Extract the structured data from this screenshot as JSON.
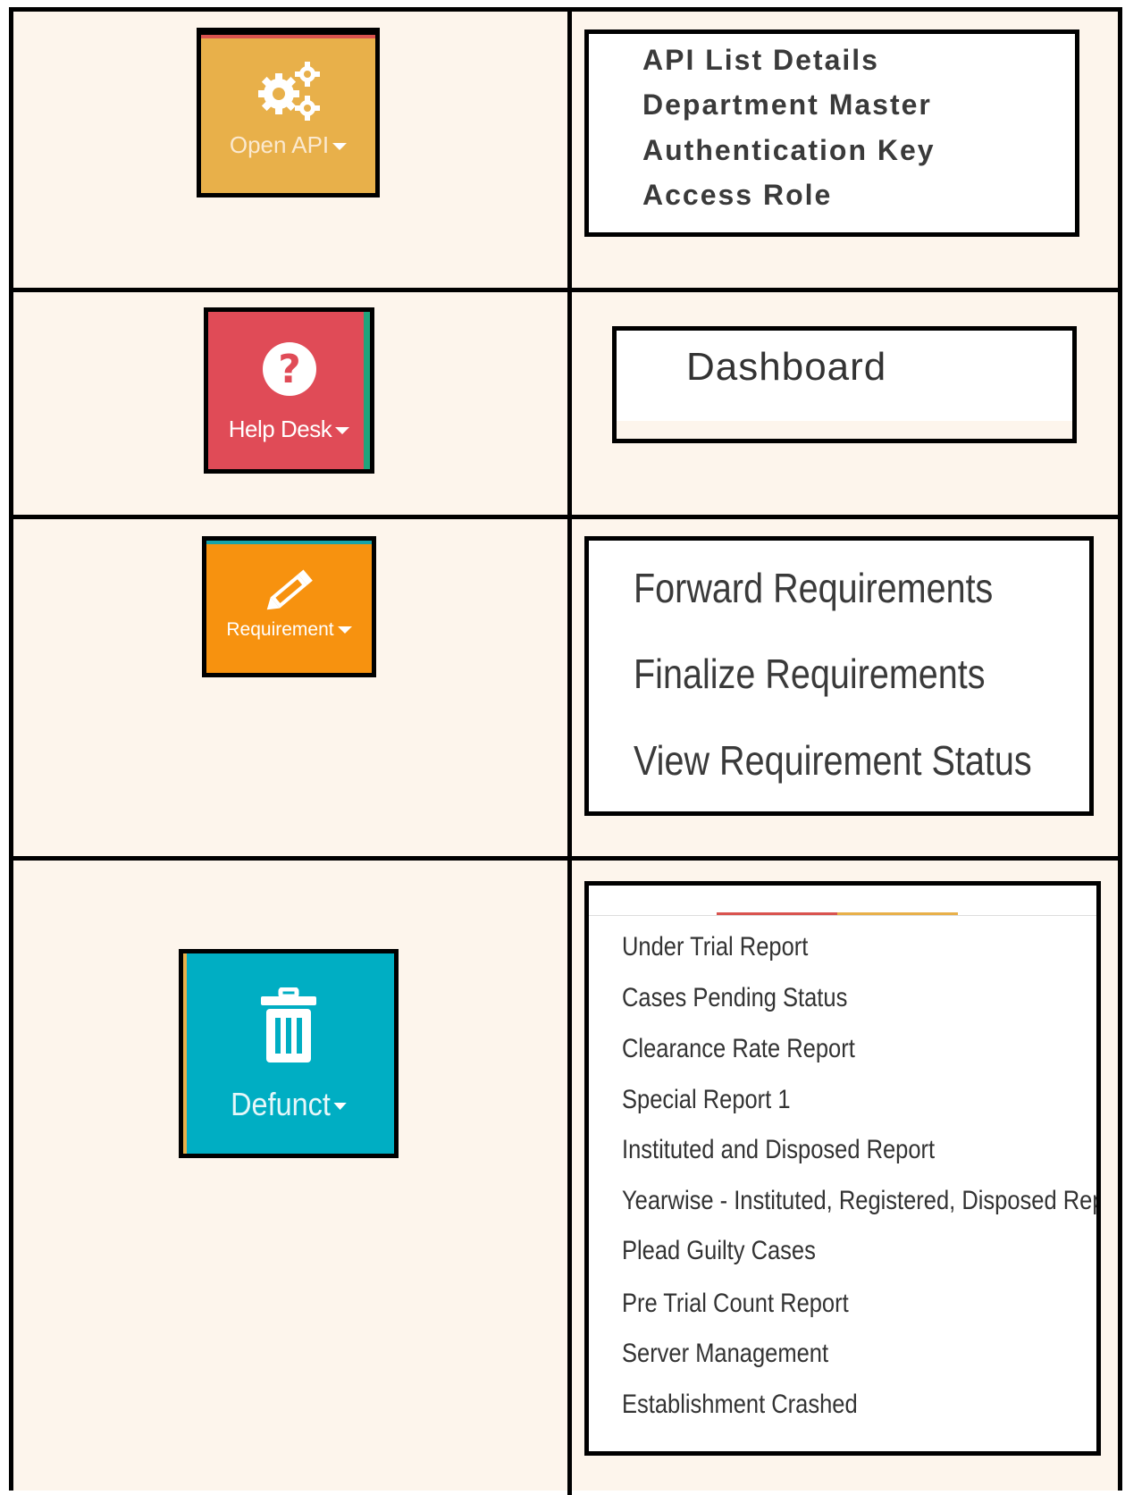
{
  "colors": {
    "open_api_tile": "#e8b04a",
    "help_desk_tile": "#e04b57",
    "requirement_tile": "#f7920f",
    "defunct_tile": "#00aec3",
    "sheet_background": "#fdf5ec"
  },
  "rows": [
    {
      "tile": {
        "label": "Open API",
        "icon": "gears-icon"
      },
      "menu": {
        "items": [
          "API List Details",
          "Department Master",
          "Authentication Key",
          "Access Role"
        ]
      }
    },
    {
      "tile": {
        "label": "Help Desk",
        "icon": "question-circle-icon"
      },
      "menu": {
        "items": [
          "Dashboard"
        ]
      }
    },
    {
      "tile": {
        "label": "Requirement",
        "icon": "pencil-icon"
      },
      "menu": {
        "items": [
          "Forward Requirements",
          "Finalize Requirements",
          "View Requirement Status"
        ]
      }
    },
    {
      "tile": {
        "label": "Defunct",
        "icon": "trash-icon"
      },
      "menu": {
        "items": [
          "Under Trial Report",
          "Cases Pending Status",
          "Clearance Rate Report",
          "Special Report 1",
          "Instituted and Disposed Report",
          "Yearwise - Instituted, Registered, Disposed Report",
          "Plead Guilty Cases",
          "Pre Trial Count Report",
          "Server Management",
          "Establishment Crashed"
        ]
      }
    }
  ]
}
